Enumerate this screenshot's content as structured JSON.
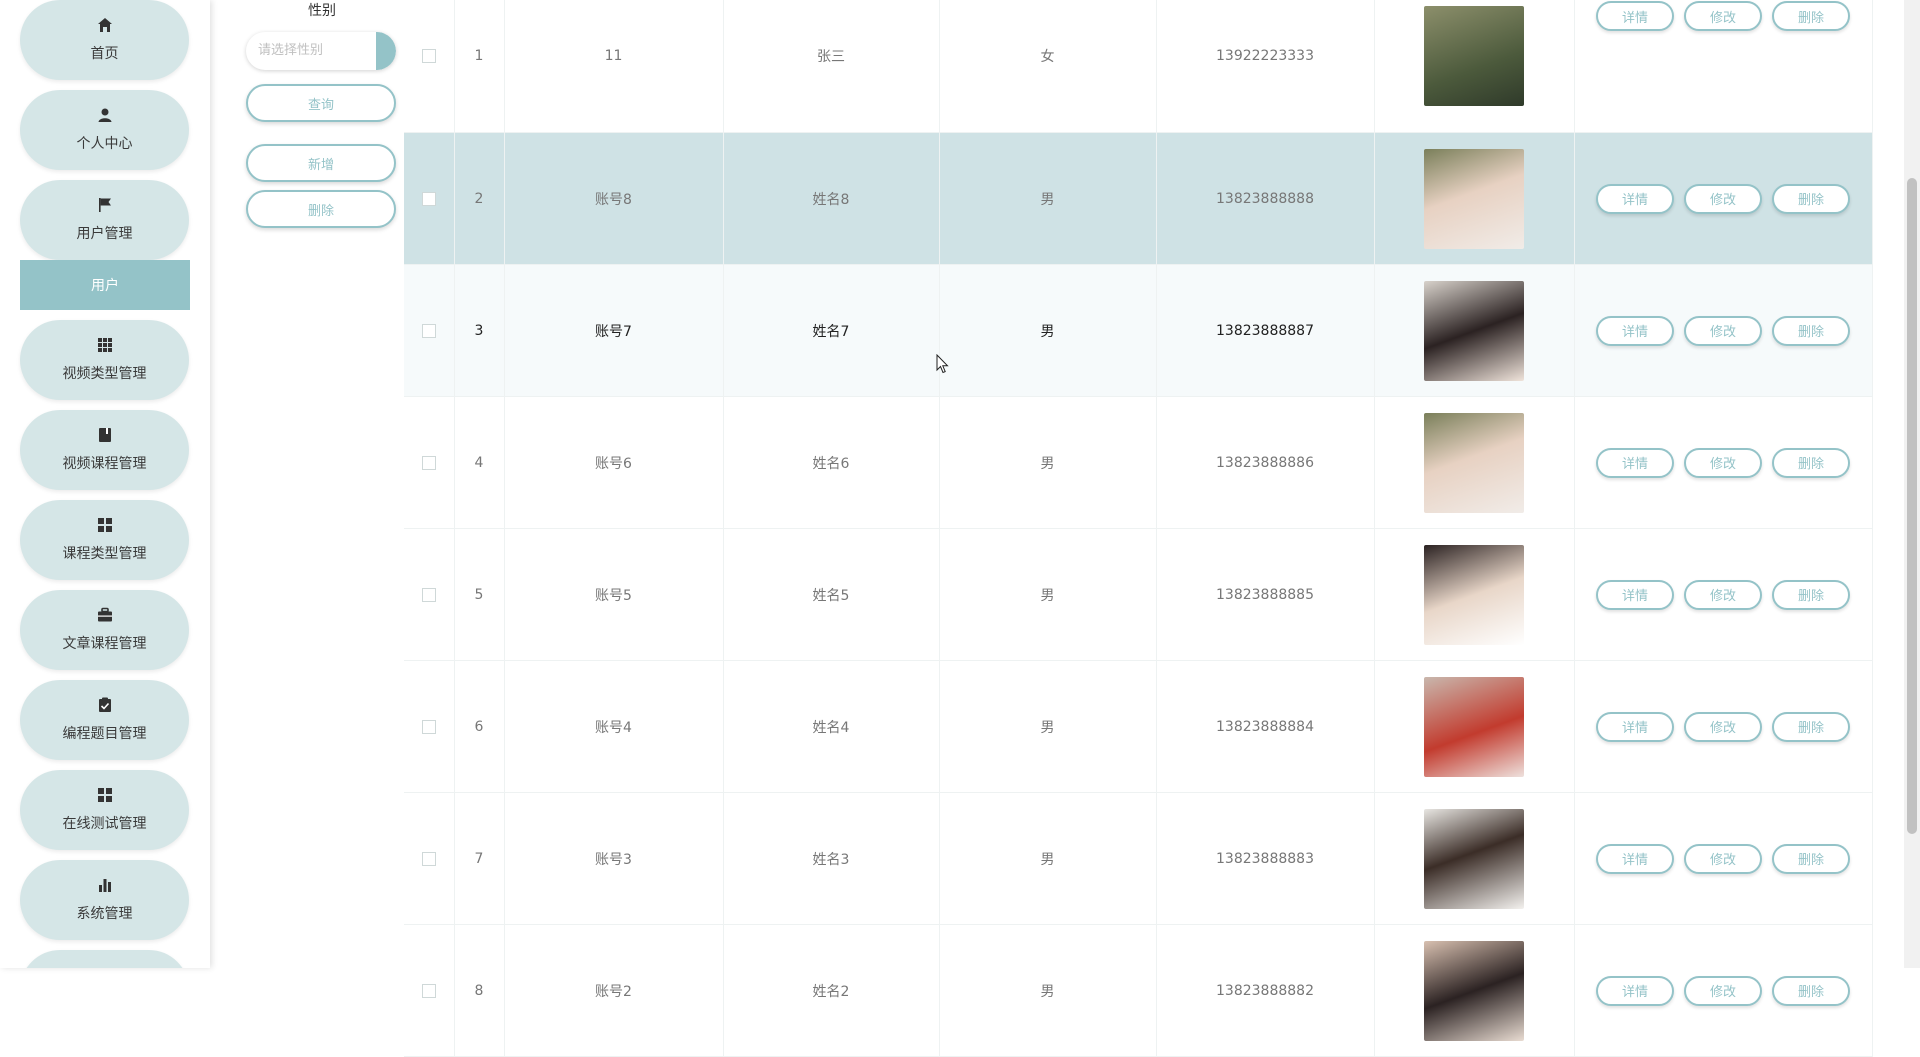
{
  "sidebar": {
    "items": [
      {
        "label": "首页",
        "icon": "home-icon"
      },
      {
        "label": "个人中心",
        "icon": "user-icon"
      },
      {
        "label": "用户管理",
        "icon": "flag-icon"
      },
      {
        "label": "视频类型管理",
        "icon": "grid-icon"
      },
      {
        "label": "视频课程管理",
        "icon": "book-icon"
      },
      {
        "label": "课程类型管理",
        "icon": "apps-icon"
      },
      {
        "label": "文章课程管理",
        "icon": "briefcase-icon"
      },
      {
        "label": "编程题目管理",
        "icon": "clipboard-check-icon"
      },
      {
        "label": "在线测试管理",
        "icon": "apps-icon"
      },
      {
        "label": "系统管理",
        "icon": "bar-chart-icon"
      }
    ],
    "active_sub_item": "用户"
  },
  "search": {
    "gender_label": "性别",
    "gender_placeholder": "请选择性别",
    "query_label": "查询",
    "add_label": "新增",
    "delete_label": "删除"
  },
  "table": {
    "actions": {
      "detail": "详情",
      "edit": "修改",
      "delete": "删除"
    },
    "rows": [
      {
        "index": "1",
        "account": "11",
        "name": "张三",
        "gender": "女",
        "phone": "13922223333"
      },
      {
        "index": "2",
        "account": "账号8",
        "name": "姓名8",
        "gender": "男",
        "phone": "13823888888"
      },
      {
        "index": "3",
        "account": "账号7",
        "name": "姓名7",
        "gender": "男",
        "phone": "13823888887"
      },
      {
        "index": "4",
        "account": "账号6",
        "name": "姓名6",
        "gender": "男",
        "phone": "13823888886"
      },
      {
        "index": "5",
        "account": "账号5",
        "name": "姓名5",
        "gender": "男",
        "phone": "13823888885"
      },
      {
        "index": "6",
        "account": "账号4",
        "name": "姓名4",
        "gender": "男",
        "phone": "13823888884"
      },
      {
        "index": "7",
        "account": "账号3",
        "name": "姓名3",
        "gender": "男",
        "phone": "13823888883"
      },
      {
        "index": "8",
        "account": "账号2",
        "name": "姓名2",
        "gender": "男",
        "phone": "13823888882"
      }
    ]
  },
  "colors": {
    "accent": "#94c3c8",
    "nav_bg": "#d5e6e7",
    "selected_row": "#cfe2e5"
  }
}
